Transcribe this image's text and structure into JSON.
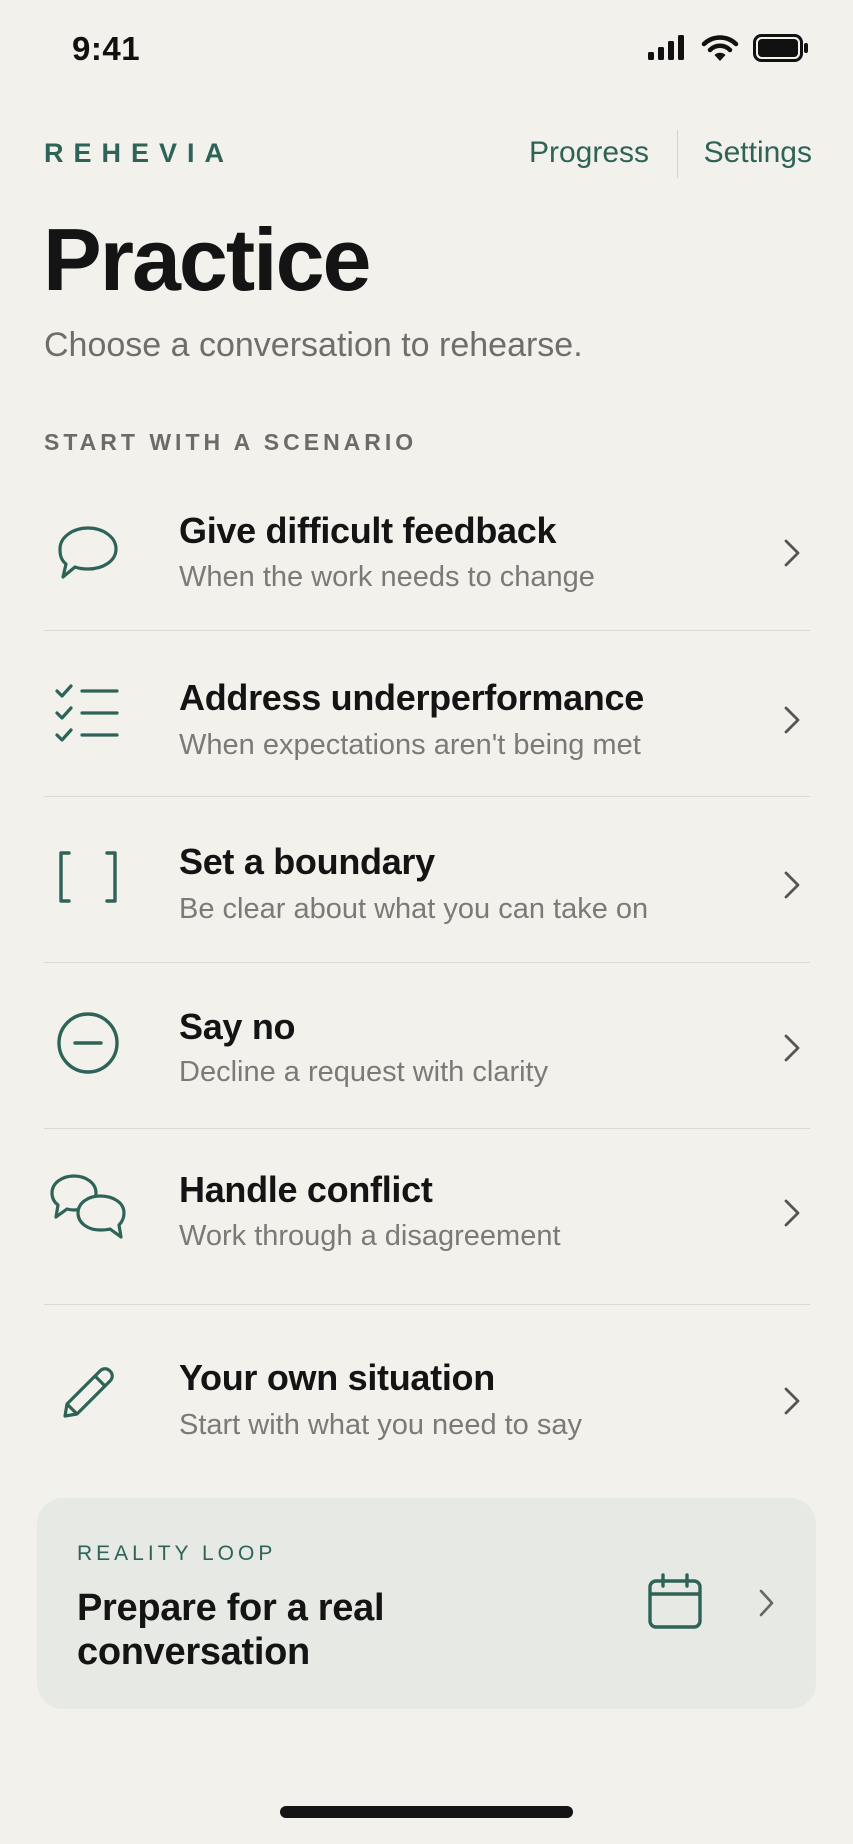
{
  "status_bar": {
    "time": "9:41"
  },
  "nav": {
    "brand": "REHEVIA",
    "progress_label": "Progress",
    "settings_label": "Settings"
  },
  "header": {
    "title": "Practice",
    "subtitle": "Choose a conversation to rehearse."
  },
  "section": {
    "label": "START WITH A SCENARIO"
  },
  "scenarios": [
    {
      "title": "Give difficult feedback",
      "description": "When the work needs to change",
      "icon": "speech-bubble-icon"
    },
    {
      "title": "Address underperformance",
      "description": "When expectations aren't being met",
      "icon": "checklist-icon"
    },
    {
      "title": "Set a boundary",
      "description": "Be clear about what you can take on",
      "icon": "brackets-icon"
    },
    {
      "title": "Say no",
      "description": "Decline a request with clarity",
      "icon": "minus-circle-icon"
    },
    {
      "title": "Handle conflict",
      "description": "Work through a disagreement",
      "icon": "two-speech-bubbles-icon"
    },
    {
      "title": "Your own situation",
      "description": "Start with what you need to say",
      "icon": "pencil-icon"
    }
  ],
  "reality_loop": {
    "eyebrow": "REALITY LOOP",
    "title": "Prepare for a real conversation",
    "icon": "calendar-icon"
  },
  "colors": {
    "background": "#F3F1EC",
    "accent": "#2E6357",
    "card": "#E6E9E4"
  }
}
